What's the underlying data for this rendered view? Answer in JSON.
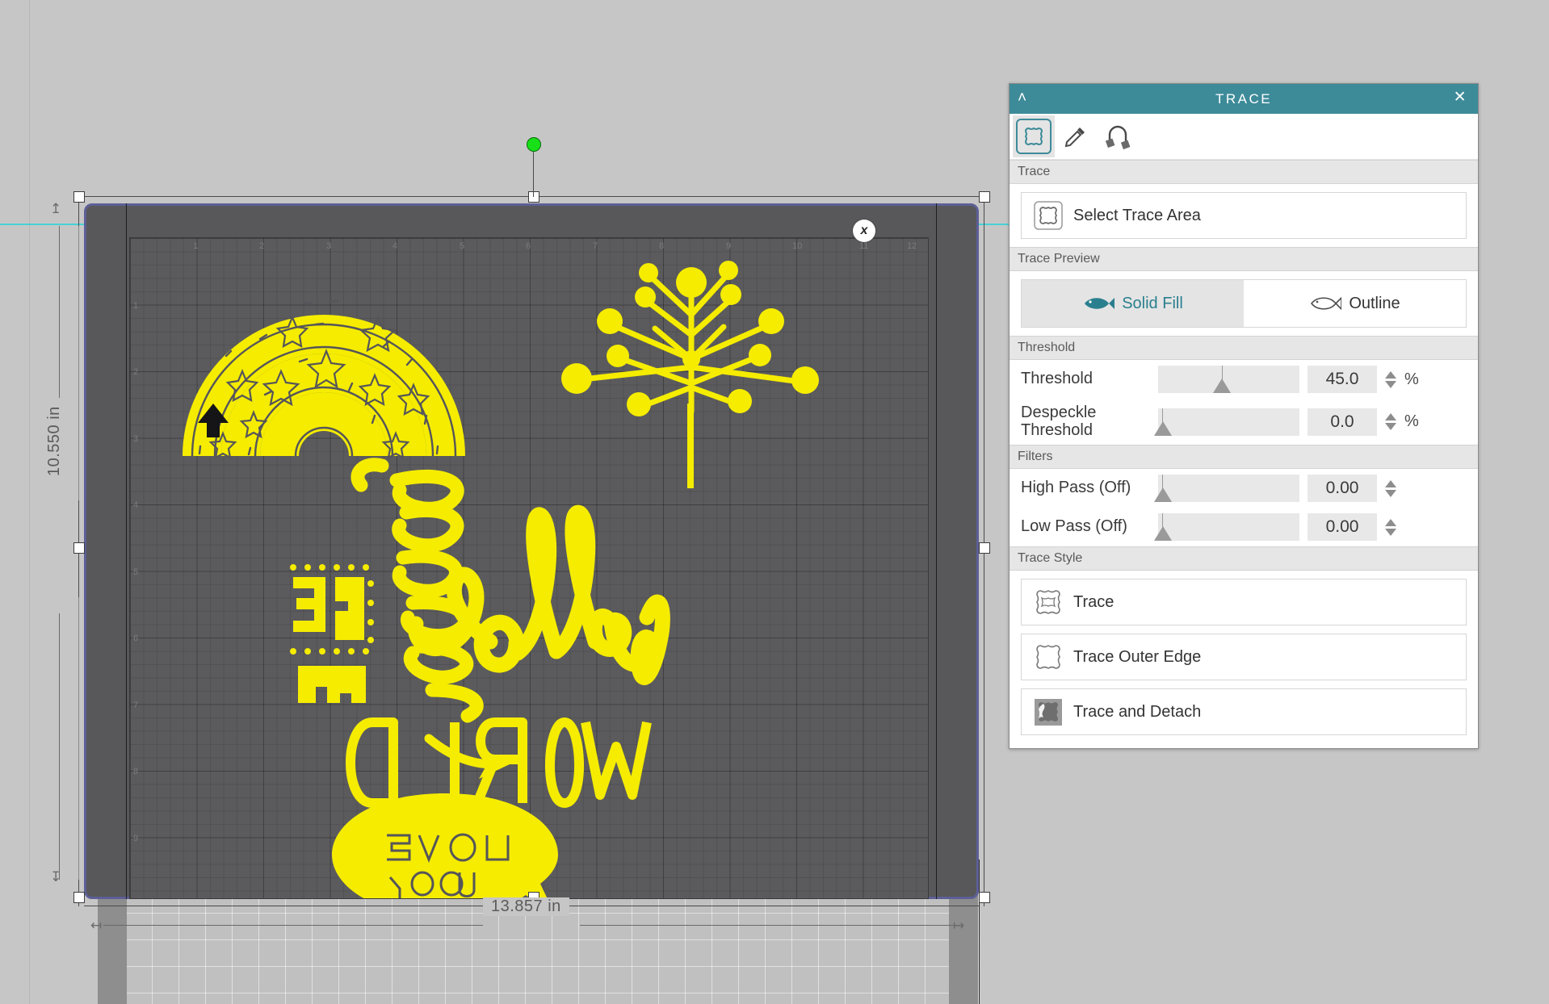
{
  "app": {
    "background_color": "#c6c6c6",
    "accent_teal": "#3d8b99",
    "artwork_color": "#f5ec00",
    "mat_color": "#58585a"
  },
  "canvas": {
    "width_label": "13.857 in",
    "height_label": "10.550 in",
    "close_glyph": "x",
    "mat_ruler_top": [
      "1",
      "2",
      "3",
      "4",
      "5",
      "6",
      "7",
      "8",
      "9",
      "10",
      "11",
      "12"
    ],
    "mat_ruler_left": [
      "1",
      "2",
      "3",
      "4",
      "5",
      "6",
      "7",
      "8",
      "9"
    ],
    "artwork_texts": [
      "BE",
      "brave",
      "hello",
      "WORLD",
      "LOVE YOU"
    ]
  },
  "trace": {
    "title": "TRACE",
    "collapse_glyph": "˄",
    "close_glyph": "✕",
    "tools": [
      {
        "name": "trace-shape-tool",
        "selected": true
      },
      {
        "name": "eyedropper-tool",
        "selected": false
      },
      {
        "name": "magnet-tool",
        "selected": false
      }
    ],
    "sections": {
      "trace": "Trace",
      "trace_preview": "Trace Preview",
      "threshold": "Threshold",
      "filters": "Filters",
      "trace_style": "Trace Style"
    },
    "select_trace_area": "Select Trace Area",
    "preview": {
      "solid_fill": "Solid Fill",
      "outline": "Outline",
      "selected": "Solid Fill"
    },
    "threshold": {
      "label": "Threshold",
      "value": "45.0",
      "unit": "%",
      "percent_pos": 45
    },
    "despeckle": {
      "label_line1": "Despeckle",
      "label_line2": "Threshold",
      "value": "0.0",
      "unit": "%",
      "percent_pos": 0
    },
    "high_pass": {
      "label": "High Pass  (Off)",
      "value": "0.00",
      "percent_pos": 0
    },
    "low_pass": {
      "label": "Low Pass  (Off)",
      "value": "0.00",
      "percent_pos": 0
    },
    "styles": [
      {
        "label": "Trace",
        "icon": "trace-outline-icon"
      },
      {
        "label": "Trace Outer Edge",
        "icon": "trace-outer-edge-icon"
      },
      {
        "label": "Trace and Detach",
        "icon": "trace-and-detach-icon"
      }
    ]
  }
}
